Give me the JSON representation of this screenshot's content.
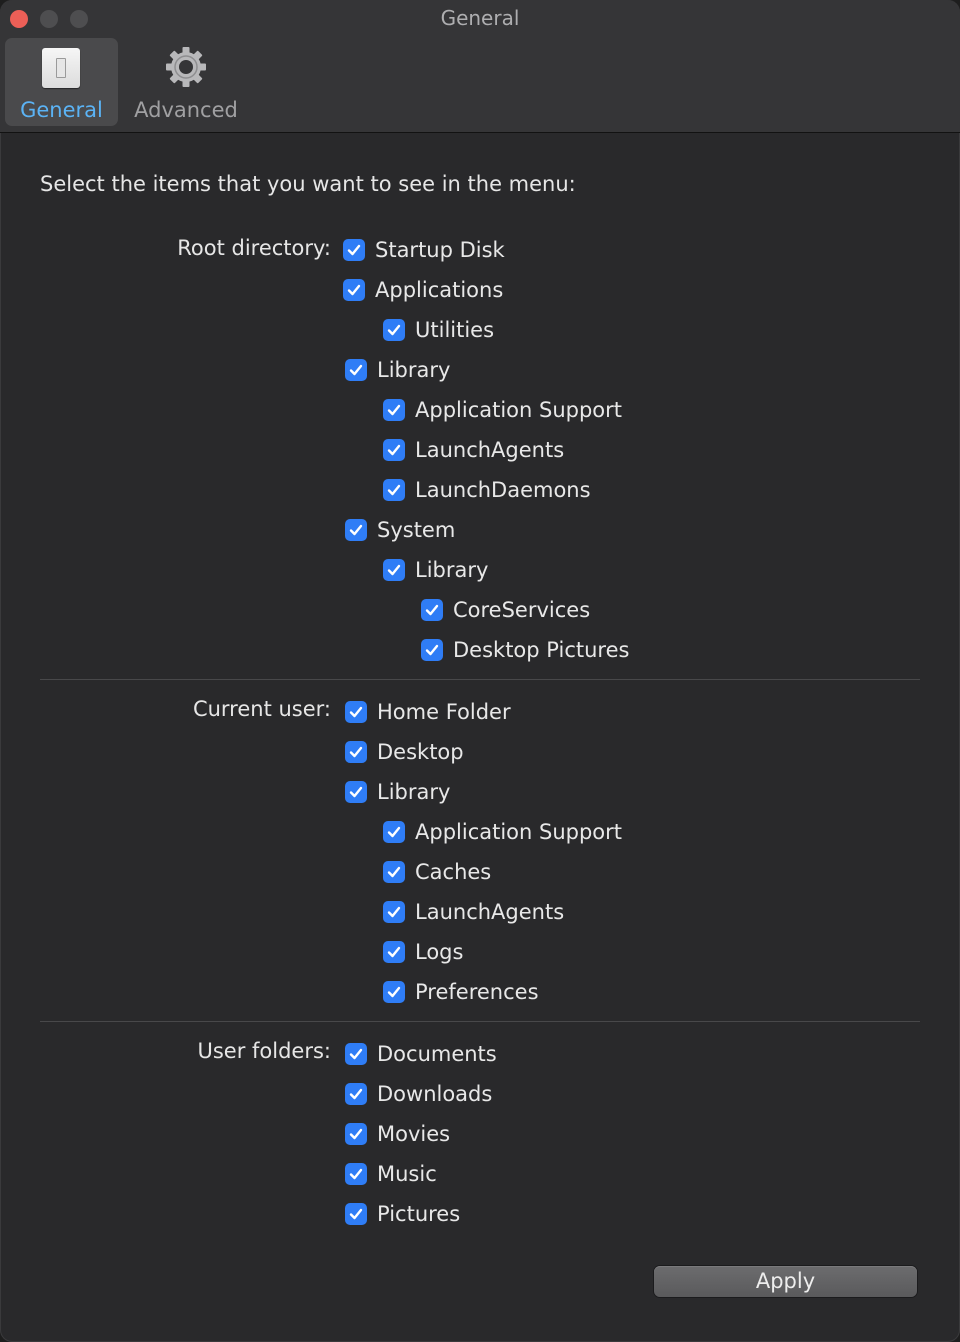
{
  "window": {
    "title": "General"
  },
  "toolbar": {
    "items": [
      {
        "label": "General",
        "icon": "general-preferences-icon",
        "selected": true
      },
      {
        "label": "Advanced",
        "icon": "gear-icon",
        "selected": false
      }
    ]
  },
  "heading": "Select the items that you want to see in the menu:",
  "groups": [
    {
      "label": "Root directory:",
      "items": [
        {
          "label": "Startup Disk",
          "checked": true
        },
        {
          "label": "Applications",
          "checked": true
        },
        {
          "label": "Utilities",
          "checked": true
        },
        {
          "label": "Library",
          "checked": true
        },
        {
          "label": "Application Support",
          "checked": true
        },
        {
          "label": "LaunchAgents",
          "checked": true
        },
        {
          "label": "LaunchDaemons",
          "checked": true
        },
        {
          "label": "System",
          "checked": true
        },
        {
          "label": "Library",
          "checked": true
        },
        {
          "label": "CoreServices",
          "checked": true
        },
        {
          "label": "Desktop Pictures",
          "checked": true
        }
      ]
    },
    {
      "label": "Current user:",
      "items": [
        {
          "label": "Home Folder",
          "checked": true
        },
        {
          "label": "Desktop",
          "checked": true
        },
        {
          "label": "Library",
          "checked": true
        },
        {
          "label": "Application Support",
          "checked": true
        },
        {
          "label": "Caches",
          "checked": true
        },
        {
          "label": "LaunchAgents",
          "checked": true
        },
        {
          "label": "Logs",
          "checked": true
        },
        {
          "label": "Preferences",
          "checked": true
        }
      ]
    },
    {
      "label": "User folders:",
      "items": [
        {
          "label": "Documents",
          "checked": true
        },
        {
          "label": "Downloads",
          "checked": true
        },
        {
          "label": "Movies",
          "checked": true
        },
        {
          "label": "Music",
          "checked": true
        },
        {
          "label": "Pictures",
          "checked": true
        }
      ]
    }
  ],
  "apply_label": "Apply",
  "colors": {
    "accent": "#2f7df6",
    "selected_tab_text": "#5bb3f5",
    "close_button": "#ec5f57"
  }
}
